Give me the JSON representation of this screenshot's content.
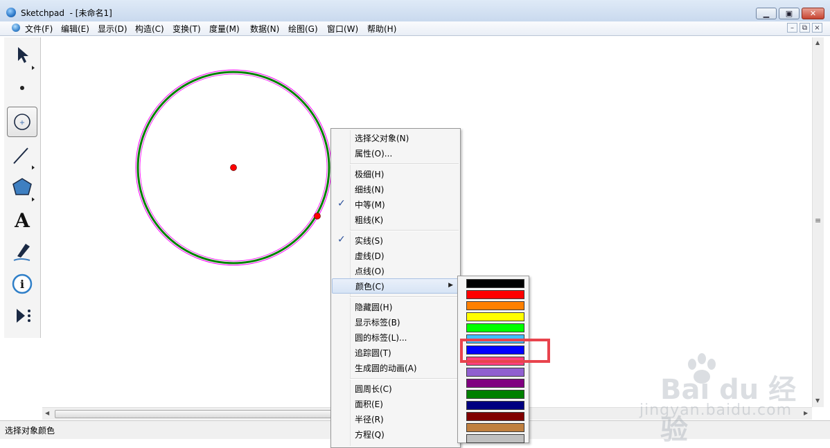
{
  "window": {
    "title": "Sketchpad  - [未命名1]",
    "buttons": [
      "minimize",
      "maximize",
      "close"
    ]
  },
  "menubar": {
    "items": [
      "文件(F)",
      "编辑(E)",
      "显示(D)",
      "构造(C)",
      "变换(T)",
      "度量(M)",
      "数据(N)",
      "绘图(G)",
      "窗口(W)",
      "帮助(H)"
    ]
  },
  "toolbox": {
    "tools": [
      "arrow-select-icon",
      "point-tool-icon",
      "compass-tool-icon",
      "straightedge-tool-icon",
      "polygon-tool-icon",
      "text-tool-icon",
      "marker-tool-icon",
      "information-tool-icon",
      "custom-tool-icon"
    ],
    "selected": "compass-tool-icon"
  },
  "context_menu": {
    "items": [
      {
        "label": "选择父对象(N)",
        "checked": false
      },
      {
        "label": "属性(O)...",
        "checked": false
      },
      {
        "label": "极细(H)",
        "checked": false
      },
      {
        "label": "细线(N)",
        "checked": false
      },
      {
        "label": "中等(M)",
        "checked": true
      },
      {
        "label": "粗线(K)",
        "checked": false
      },
      {
        "label": "实线(S)",
        "checked": true
      },
      {
        "label": "虚线(D)",
        "checked": false
      },
      {
        "label": "点线(O)",
        "checked": false
      },
      {
        "label": "颜色(C)",
        "checked": false,
        "submenu": true,
        "highlighted": true
      },
      {
        "label": "隐藏圆(H)",
        "checked": false
      },
      {
        "label": "显示标签(B)",
        "checked": false
      },
      {
        "label": "圆的标签(L)...",
        "checked": false
      },
      {
        "label": "追踪圆(T)",
        "checked": false
      },
      {
        "label": "生成圆的动画(A)",
        "checked": false
      },
      {
        "label": "圆周长(C)",
        "checked": false
      },
      {
        "label": "面积(E)",
        "checked": false
      },
      {
        "label": "半径(R)",
        "checked": false
      },
      {
        "label": "方程(Q)",
        "checked": false
      }
    ],
    "check_glyph": "✓",
    "submenu_arrow": "▶"
  },
  "color_palette": {
    "swatches": [
      "#000000",
      "#ff0000",
      "#ff8000",
      "#ffff00",
      "#00ff00",
      "#40c0ff",
      "#0000ff",
      "#ff4080",
      "#9060d0",
      "#800080",
      "#008000",
      "#000080",
      "#800000",
      "#c08040",
      "#c0c0c0"
    ],
    "selected": "#0000ff"
  },
  "canvas": {
    "circle_stroke": "#008000",
    "circle_highlight": "#ff00ff",
    "point_color": "#ff0000"
  },
  "annotation": {
    "box_color": "#e8434d"
  },
  "watermark": {
    "brand": "Bai du 经验",
    "url": "jingyan.baidu.com"
  },
  "statusbar": {
    "text": "选择对象颜色"
  }
}
